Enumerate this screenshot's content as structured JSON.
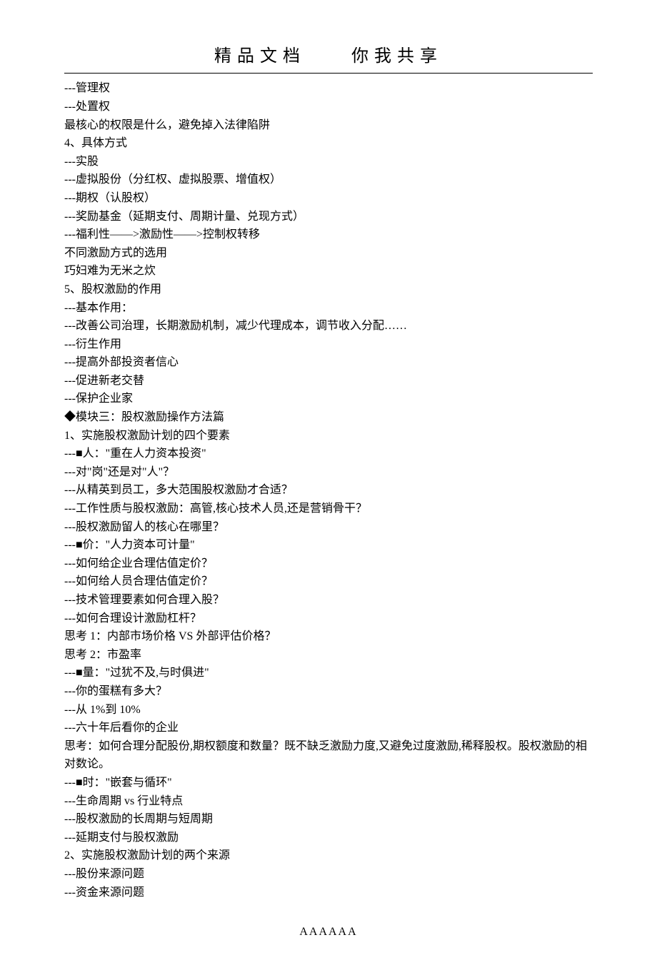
{
  "header": {
    "title": "精品文档　　你我共享"
  },
  "content": {
    "lines": [
      "---管理权",
      "---处置权",
      "最核心的权限是什么，避免掉入法律陷阱",
      "4、具体方式",
      "---实股",
      "---虚拟股份（分红权、虚拟股票、增值权）",
      "---期权（认股权）",
      "---奖励基金（延期支付、周期计量、兑现方式）",
      "---福利性——>激励性——>控制权转移",
      "不同激励方式的选用",
      "巧妇难为无米之炊",
      "5、股权激励的作用",
      "---基本作用：",
      "---改善公司治理，长期激励机制，减少代理成本，调节收入分配……",
      "---衍生作用",
      "---提高外部投资者信心",
      "---促进新老交替",
      "---保护企业家",
      "◆模块三：股权激励操作方法篇",
      "1、实施股权激励计划的四个要素",
      "---■人：\"重在人力资本投资\"",
      "---对\"岗\"还是对\"人\"？",
      "---从精英到员工，多大范围股权激励才合适？",
      "---工作性质与股权激励：高管,核心技术人员,还是营销骨干？",
      "---股权激励留人的核心在哪里？",
      "---■价：\"人力资本可计量\"",
      "---如何给企业合理估值定价？",
      "---如何给人员合理估值定价？",
      "---技术管理要素如何合理入股？",
      "---如何合理设计激励杠杆？",
      "思考 1：内部市场价格 VS 外部评估价格？",
      "思考 2：市盈率",
      "---■量：\"过犹不及,与时俱进\"",
      "---你的蛋糕有多大？",
      "---从 1%到 10%",
      "---六十年后看你的企业",
      "思考：如何合理分配股份,期权额度和数量？既不缺乏激励力度,又避免过度激励,稀释股权。股权激励的相对数论。",
      "---■时：\"嵌套与循环\"",
      "---生命周期 vs 行业特点",
      "---股权激励的长周期与短周期",
      "---延期支付与股权激励",
      "2、实施股权激励计划的两个来源",
      "---股份来源问题",
      "---资金来源问题"
    ]
  },
  "footer": {
    "text": "AAAAAA"
  }
}
